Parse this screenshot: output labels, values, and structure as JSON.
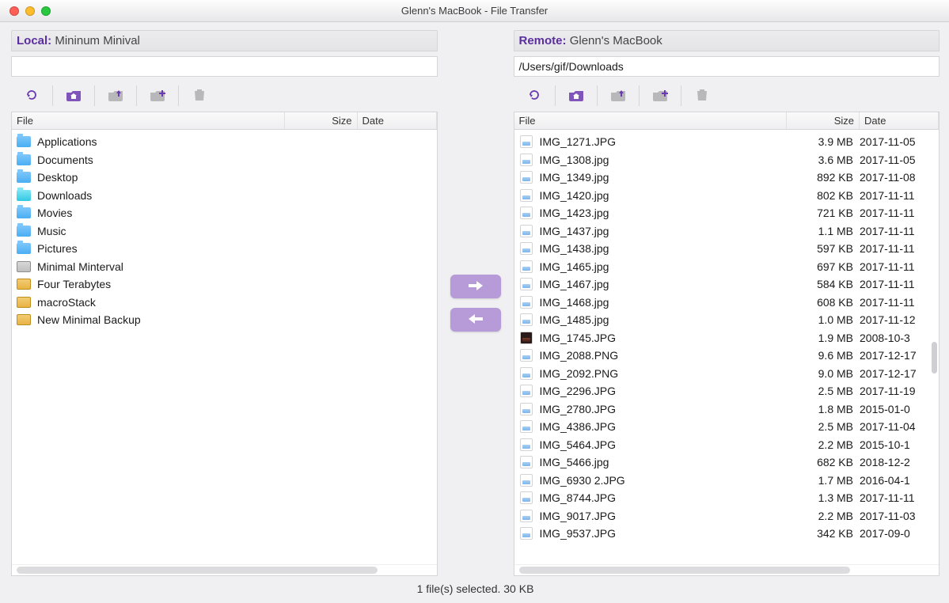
{
  "window": {
    "title": "Glenn's MacBook - File Transfer"
  },
  "columns": {
    "file": "File",
    "size": "Size",
    "date": "Date"
  },
  "toolbar": {
    "refresh": "refresh",
    "home": "home",
    "up": "go-up",
    "newfolder": "new-folder",
    "trash": "trash"
  },
  "local": {
    "label": "Local:",
    "name": "Mininum Minival",
    "path": "",
    "items": [
      {
        "icon": "folder",
        "name": "Applications"
      },
      {
        "icon": "folder",
        "name": "Documents"
      },
      {
        "icon": "folder",
        "name": "Desktop"
      },
      {
        "icon": "folder-cyan",
        "name": "Downloads"
      },
      {
        "icon": "folder",
        "name": "Movies"
      },
      {
        "icon": "folder",
        "name": "Music"
      },
      {
        "icon": "folder",
        "name": "Pictures"
      },
      {
        "icon": "drive-gray",
        "name": "Minimal Minterval"
      },
      {
        "icon": "drive",
        "name": "Four Terabytes"
      },
      {
        "icon": "drive",
        "name": "macroStack"
      },
      {
        "icon": "drive",
        "name": "New Minimal Backup"
      }
    ]
  },
  "remote": {
    "label": "Remote:",
    "name": "Glenn's MacBook",
    "path": "/Users/gif/Downloads",
    "items": [
      {
        "icon": "img",
        "name": "IMG_1271.JPG",
        "size": "3.9 MB",
        "date": "2017-11-05"
      },
      {
        "icon": "img",
        "name": "IMG_1308.jpg",
        "size": "3.6 MB",
        "date": "2017-11-05"
      },
      {
        "icon": "img",
        "name": "IMG_1349.jpg",
        "size": "892 KB",
        "date": "2017-11-08"
      },
      {
        "icon": "img",
        "name": "IMG_1420.jpg",
        "size": "802 KB",
        "date": "2017-11-11"
      },
      {
        "icon": "img",
        "name": "IMG_1423.jpg",
        "size": "721 KB",
        "date": "2017-11-11"
      },
      {
        "icon": "img",
        "name": "IMG_1437.jpg",
        "size": "1.1 MB",
        "date": "2017-11-11"
      },
      {
        "icon": "img",
        "name": "IMG_1438.jpg",
        "size": "597 KB",
        "date": "2017-11-11"
      },
      {
        "icon": "img",
        "name": "IMG_1465.jpg",
        "size": "697 KB",
        "date": "2017-11-11"
      },
      {
        "icon": "img",
        "name": "IMG_1467.jpg",
        "size": "584 KB",
        "date": "2017-11-11"
      },
      {
        "icon": "img",
        "name": "IMG_1468.jpg",
        "size": "608 KB",
        "date": "2017-11-11"
      },
      {
        "icon": "img",
        "name": "IMG_1485.jpg",
        "size": "1.0 MB",
        "date": "2017-11-12"
      },
      {
        "icon": "img-dark",
        "name": "IMG_1745.JPG",
        "size": "1.9 MB",
        "date": "2008-10-3"
      },
      {
        "icon": "img",
        "name": "IMG_2088.PNG",
        "size": "9.6 MB",
        "date": "2017-12-17"
      },
      {
        "icon": "img",
        "name": "IMG_2092.PNG",
        "size": "9.0 MB",
        "date": "2017-12-17"
      },
      {
        "icon": "img",
        "name": "IMG_2296.JPG",
        "size": "2.5 MB",
        "date": "2017-11-19"
      },
      {
        "icon": "img",
        "name": "IMG_2780.JPG",
        "size": "1.8 MB",
        "date": "2015-01-0"
      },
      {
        "icon": "img",
        "name": "IMG_4386.JPG",
        "size": "2.5 MB",
        "date": "2017-11-04"
      },
      {
        "icon": "img",
        "name": "IMG_5464.JPG",
        "size": "2.2 MB",
        "date": "2015-10-1"
      },
      {
        "icon": "img",
        "name": "IMG_5466.jpg",
        "size": "682 KB",
        "date": "2018-12-2"
      },
      {
        "icon": "img",
        "name": "IMG_6930 2.JPG",
        "size": "1.7 MB",
        "date": "2016-04-1"
      },
      {
        "icon": "img",
        "name": "IMG_8744.JPG",
        "size": "1.3 MB",
        "date": "2017-11-11"
      },
      {
        "icon": "img",
        "name": "IMG_9017.JPG",
        "size": "2.2 MB",
        "date": "2017-11-03"
      },
      {
        "icon": "img",
        "name": "IMG_9537.JPG",
        "size": "342 KB",
        "date": "2017-09-0"
      }
    ]
  },
  "status": "1 file(s) selected. 30 KB"
}
